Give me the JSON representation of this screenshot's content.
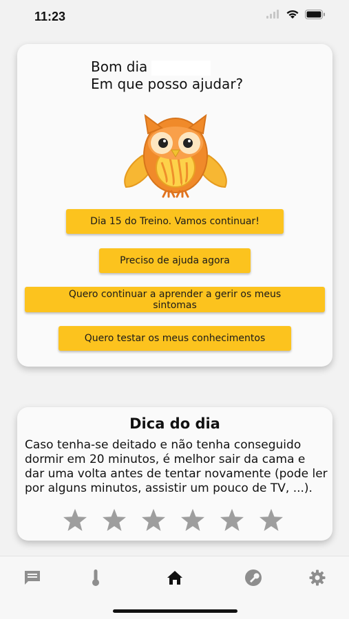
{
  "status_bar": {
    "time": "11:23"
  },
  "greeting": {
    "line1": "Bom dia",
    "line2": "Em que posso ajudar?"
  },
  "actions": [
    {
      "label": "Dia 15 do Treino. Vamos continuar!"
    },
    {
      "label": "Preciso de ajuda agora"
    },
    {
      "label": "Quero continuar a aprender a gerir os meus sintomas"
    },
    {
      "label": "Quero testar os meus conhecimentos"
    }
  ],
  "tip": {
    "title": "Dica do dia",
    "text": "Caso tenha-se deitado e não tenha conseguido dormir em 20 minutos, é melhor sair da cama e dar uma volta antes de tentar novamente (pode ler por alguns minutos, assistir um pouco de TV, ...).",
    "rating": 0,
    "max_rating": 5
  },
  "nav": {
    "items": [
      "chat-icon",
      "thermometer-icon",
      "home-icon",
      "wrench-icon",
      "gear-icon"
    ],
    "active": "home-icon"
  },
  "colors": {
    "accent": "#fcc31e",
    "star": "#9e9e9e",
    "nav_icon": "#8e8e8e",
    "nav_active": "#111111"
  }
}
